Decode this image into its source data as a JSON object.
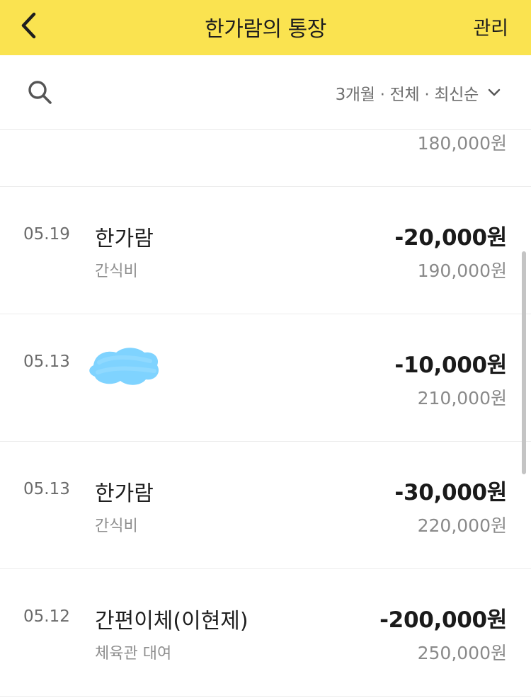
{
  "header": {
    "title": "한가람의 통장",
    "manage_label": "관리"
  },
  "toolbar": {
    "filter_label": "3개월 · 전체 · 최신순"
  },
  "partial_row": {
    "balance": "180,000원"
  },
  "transactions": [
    {
      "date": "05.19",
      "name": "한가람",
      "memo": "간식비",
      "amount": "-20,000원",
      "balance": "190,000원"
    },
    {
      "date": "05.13",
      "name": "",
      "memo": "",
      "amount": "-10,000원",
      "balance": "210,000원",
      "name_redacted": true
    },
    {
      "date": "05.13",
      "name": "한가람",
      "memo": "간식비",
      "amount": "-30,000원",
      "balance": "220,000원"
    },
    {
      "date": "05.12",
      "name": "간편이체(이현제)",
      "memo": "체육관 대여",
      "amount": "-200,000원",
      "balance": "250,000원"
    }
  ],
  "colors": {
    "header_bg": "#fae350",
    "redaction": "#7fd3ff"
  },
  "icons": [
    "back-arrow-icon",
    "search-icon",
    "chevron-down-icon"
  ]
}
